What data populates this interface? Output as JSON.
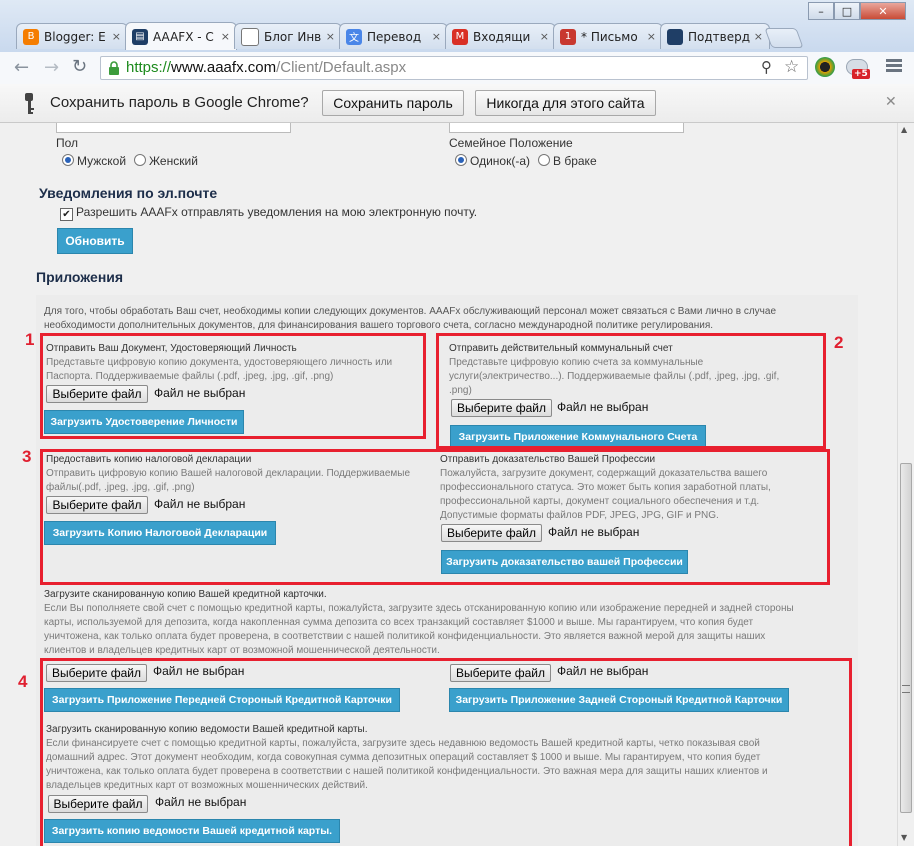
{
  "tabs": [
    {
      "label": "Blogger: E",
      "icon": "blogger-icon",
      "color": "#f57d00",
      "active": false
    },
    {
      "label": "AAAFX - C",
      "icon": "aaafx-icon",
      "color": "#1f3e66",
      "active": true
    },
    {
      "label": "Блог Инв",
      "icon": "page-icon",
      "color": "#ffffff",
      "active": false
    },
    {
      "label": "Перевод",
      "icon": "translate-icon",
      "color": "#4a86e8",
      "active": false
    },
    {
      "label": "Входящи",
      "icon": "gmail-icon",
      "color": "#d93025",
      "active": false
    },
    {
      "label": "* Письмо",
      "icon": "mail-icon",
      "color": "#c8382f",
      "active": false
    },
    {
      "label": "Подтверд",
      "icon": "page-icon",
      "color": "#1f3e66",
      "active": false
    }
  ],
  "window": {
    "minimize": "–",
    "maximize": "□",
    "close": "✕"
  },
  "address": {
    "scheme": "https://",
    "host": "www.aaafx.com",
    "path": "/Client/Default.aspx"
  },
  "infobar": {
    "message": "Сохранить пароль в Google Chrome?",
    "save_label": "Сохранить пароль",
    "never_label": "Никогда для этого сайта",
    "close": "✕"
  },
  "extension_badge": "+5",
  "form": {
    "gender_label": "Пол",
    "gender_options": [
      "Мужской",
      "Женский"
    ],
    "marital_label": "Семейное Положение",
    "marital_options": [
      "Одинок(-а)",
      "В браке"
    ],
    "notify_heading": "Уведомления по эл.почте",
    "notify_checkbox": "Разрешить AAAFx отправлять уведомления на мою электронную почту.",
    "update_label": "Обновить"
  },
  "attachments": {
    "heading": "Приложения",
    "intro_line1": "Для того, чтобы обработать Ваш счет, необходимы копии следующих документов. AAAFx обслуживающий персонал может связаться с Вами лично в случае",
    "intro_line2": "необходимости дополнительных документов, для финансирования вашего торгового счета, согласно международной политике регулирования.",
    "choose_file": "Выберите файл",
    "no_file": "Файл не выбран",
    "id_doc": {
      "title": "Отправить Ваш Документ, Удостоверяющий Личность",
      "desc1": "Представьте цифровую копию документа, удостоверяющего личность или",
      "desc2": "Паспорта. Поддерживаемые файлы (.pdf, .jpeg, .jpg, .gif, .png)",
      "button": "Загрузить Удостоверение Личности"
    },
    "utility": {
      "title": "Отправить действительный коммунальный счет",
      "desc1": "Представьте цифровую копию счета за коммунальные",
      "desc2": "услуги(электричество...). Поддерживаемые файлы (.pdf, .jpeg, .jpg, .gif,",
      "desc3": ".png)",
      "button": "Загрузить Приложение Коммунального Счета"
    },
    "tax": {
      "title": "Предоставить копию налоговой декларации",
      "desc1": "Отправить цифровую копию Вашей налоговой декларации. Поддерживаемые",
      "desc2": "файлы(.pdf, .jpeg, .jpg, .gif, .png)",
      "button": "Загрузить Копию Налоговой Декларации"
    },
    "profession": {
      "title": "Отправить доказательство Вашей Профессии",
      "desc1": "Пожалуйста, загрузите документ, содержащий доказательства вашего",
      "desc2": "профессионального статуса. Это может быть копия заработной платы,",
      "desc3": "профессиональной карты, документ социального обеспечения и т.д.",
      "desc4": "Допустимые форматы файлов PDF, JPEG, JPG, GIF и PNG.",
      "button": "Загрузить доказательство вашей Профессии"
    },
    "card": {
      "title": "Загрузите сканированную копию Вашей кредитной карточки.",
      "desc1": "Если Вы пополняете свой счет с помощью кредитной карты, пожалуйста, загрузите здесь отсканированную копию или изображение передней и задней стороны",
      "desc2": "карты, используемой для депозита, когда накопленная сумма депозита со всех транзакций составляет $1000 и выше. Мы гарантируем, что копия будет",
      "desc3": "уничтожена, как только оплата будет проверена, в соответствии с нашей политикой конфиденциальности. Это является важной мерой для защиты наших",
      "desc4": "клиентов и владельцев кредитных карт от возможной мошеннической деятельности.",
      "front_button": "Загрузить Приложение Передней Стороный Кредитной Карточки",
      "back_button": "Загрузить Приложение Задней Стороный Кредитной Карточки"
    },
    "statement": {
      "title": "Загрузить сканированную копию ведомости Вашей кредитной карты.",
      "desc1": "Если финансируете счет с помощью кредитной карты, пожалуйста, загрузите здесь недавнюю ведомость Вашей кредитной карты, четко показывая свой",
      "desc2": "домашний адрес. Этот документ необходим, когда совокупная сумма депозитных операций составляет $ 1000 и выше. Мы гарантируем, что копия будет",
      "desc3": "уничтожена, как только оплата будет проверена в соответствии с нашей политикой конфиденциальности. Это важная мера для защиты наших клиентов и",
      "desc4": "владельцев кредитных карт от возможных мошеннических действий.",
      "button": "Загрузить  копию ведомости Вашей кредитной карты."
    }
  },
  "annotations": [
    "1",
    "2",
    "3",
    "4"
  ],
  "colors": {
    "button": "#3aa0cc",
    "annotation": "#e8202f",
    "heading": "#1d2e4a"
  }
}
